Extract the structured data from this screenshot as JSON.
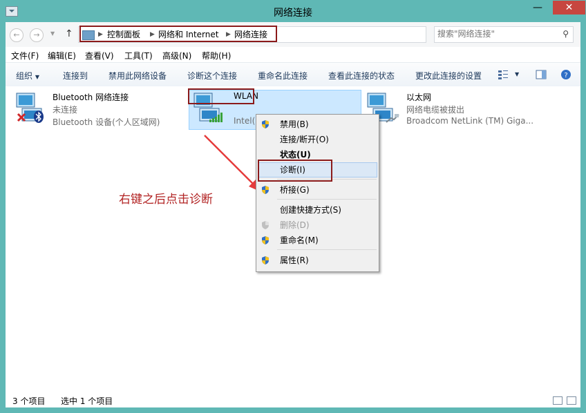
{
  "window": {
    "title": "网络连接"
  },
  "address": {
    "crumbs": [
      "控制面板",
      "网络和 Internet",
      "网络连接"
    ],
    "search_placeholder": "搜索\"网络连接\""
  },
  "menubar": [
    "文件(F)",
    "编辑(E)",
    "查看(V)",
    "工具(T)",
    "高级(N)",
    "帮助(H)"
  ],
  "commandbar": {
    "organize": "组织",
    "items": [
      "连接到",
      "禁用此网络设备",
      "诊断这个连接",
      "重命名此连接",
      "查看此连接的状态",
      "更改此连接的设置"
    ]
  },
  "connections": [
    {
      "name": "Bluetooth 网络连接",
      "status": "未连接",
      "device": "Bluetooth 设备(个人区域网)"
    },
    {
      "name": "WLAN",
      "status": "",
      "device": "Intel(R)"
    },
    {
      "name": "以太网",
      "status": "网络电缆被拔出",
      "device": "Broadcom NetLink (TM) Giga..."
    }
  ],
  "context_menu": {
    "items": [
      "禁用(B)",
      "连接/断开(O)",
      "状态(U)",
      "诊断(I)",
      "桥接(G)",
      "创建快捷方式(S)",
      "删除(D)",
      "重命名(M)",
      "属性(R)"
    ],
    "highlighted": "诊断(I)"
  },
  "annotation": "右键之后点击诊断",
  "statusbar": {
    "count": "3 个项目",
    "selected": "选中 1 个项目"
  },
  "colors": {
    "accent": "#5fb8b5",
    "highlight_box": "#8b1a1a",
    "annotation": "#b22323",
    "close": "#c7463f"
  }
}
